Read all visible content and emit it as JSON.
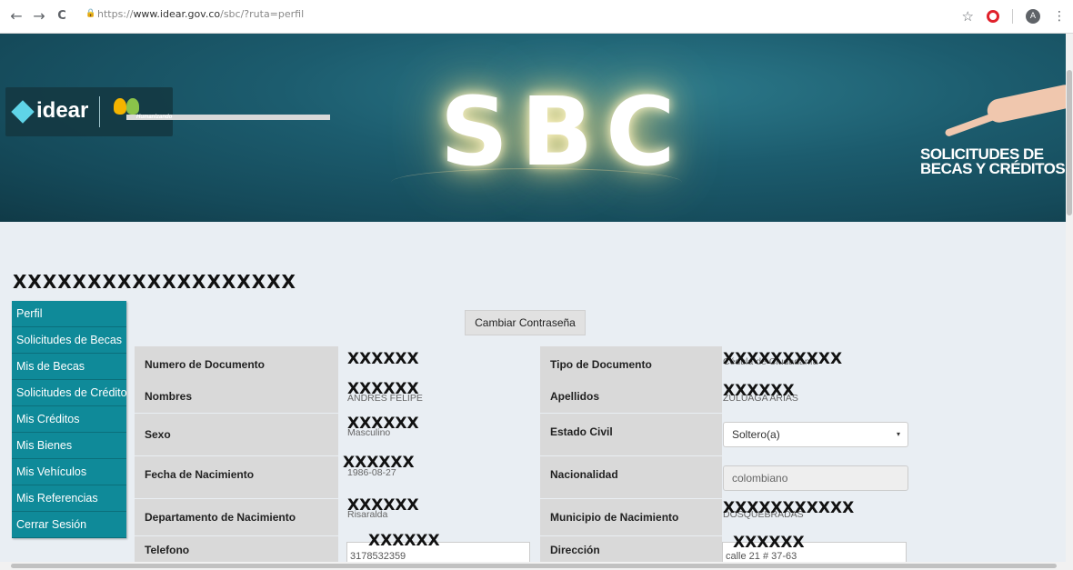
{
  "browser": {
    "back_icon": "←",
    "forward_icon": "→",
    "reload_icon": "C",
    "lock_icon": "🔒",
    "url_prefix": "https://",
    "url_main": "www.idear.gov.co",
    "url_rest": "/sbc/?ruta=perfil",
    "star_icon": "☆",
    "avatar_letter": "A",
    "menu_icon": "⋮"
  },
  "banner": {
    "logo_text": "idear",
    "logo_sub": "Humanizando",
    "sbc_text": "SBC",
    "title_line1": "SOLICITUDES DE",
    "title_line2": "BECAS Y CRÉDITOS"
  },
  "user": {
    "name": "XXXXXXXXXXXXXXXXXXX"
  },
  "sidebar": {
    "items": [
      {
        "label": "Perfil"
      },
      {
        "label": "Solicitudes de Becas"
      },
      {
        "label": "Mis de Becas"
      },
      {
        "label": "Solicitudes de Crédito"
      },
      {
        "label": "Mis Créditos"
      },
      {
        "label": "Mis Bienes"
      },
      {
        "label": "Mis Vehículos"
      },
      {
        "label": "Mis Referencias"
      },
      {
        "label": "Cerrar Sesión"
      }
    ]
  },
  "actions": {
    "change_password": "Cambiar Contraseña"
  },
  "form": {
    "numero_documento": {
      "label": "Numero de Documento",
      "redact": "XXXXXX",
      "under": ""
    },
    "tipo_documento": {
      "label": "Tipo de Documento",
      "redact": "XXXXXXXXXX",
      "under": "Cédula de Ciudadanía"
    },
    "nombres": {
      "label": "Nombres",
      "redact": "XXXXXX",
      "under": "ANDRES FELIPE"
    },
    "apellidos": {
      "label": "Apellidos",
      "redact": "XXXXXX",
      "under": "ZULUAGA ARIAS"
    },
    "sexo": {
      "label": "Sexo",
      "redact": "XXXXXX",
      "under": "Masculino"
    },
    "estado_civil": {
      "label": "Estado Civil",
      "value": "Soltero(a)",
      "caret": "▾"
    },
    "fecha_nacimiento": {
      "label": "Fecha de Nacimiento",
      "redact": "XXXXXX",
      "under": "1986-08-27"
    },
    "nacionalidad": {
      "label": "Nacionalidad",
      "value": "colombiano"
    },
    "departamento_nacimiento": {
      "label": "Departamento de Nacimiento",
      "redact": "XXXXXX",
      "under": "Risaralda"
    },
    "municipio_nacimiento": {
      "label": "Municipio de Nacimiento",
      "redact": "XXXXXXXXXXX",
      "under": "DOSQUEBRADAS"
    },
    "telefono": {
      "label": "Telefono",
      "redact": "XXXXXX",
      "value": "3178532359"
    },
    "direccion": {
      "label": "Dirección",
      "redact": "XXXXXX",
      "value": "calle 21 # 37-63"
    }
  }
}
